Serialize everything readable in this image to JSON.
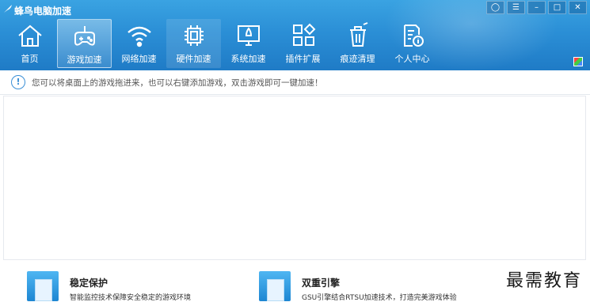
{
  "app": {
    "title": "蜂鸟电脑加速"
  },
  "tabs": [
    {
      "label": "首页",
      "icon": "home-icon"
    },
    {
      "label": "游戏加速",
      "icon": "gamepad-icon"
    },
    {
      "label": "网络加速",
      "icon": "wifi-icon"
    },
    {
      "label": "硬件加速",
      "icon": "chip-icon"
    },
    {
      "label": "系统加速",
      "icon": "monitor-rocket-icon"
    },
    {
      "label": "插件扩展",
      "icon": "plugin-grid-icon"
    },
    {
      "label": "痕迹清理",
      "icon": "trash-icon"
    },
    {
      "label": "个人中心",
      "icon": "user-document-icon"
    }
  ],
  "active_tab": "游戏加速",
  "notice": {
    "text": "您可以将桌面上的游戏拖进来，也可以右键添加游戏，双击游戏即可一键加速！"
  },
  "features": [
    {
      "title": "稳定保护",
      "desc": "智能监控技术保障安全稳定的游戏环境"
    },
    {
      "title": "双重引擎",
      "desc": "GSU引擎结合RTSU加速技术，打造完美游戏体验"
    }
  ],
  "watermark": "最需教育",
  "colors": {
    "header": "#2b8fd6",
    "accent": "#3a8fd6"
  }
}
